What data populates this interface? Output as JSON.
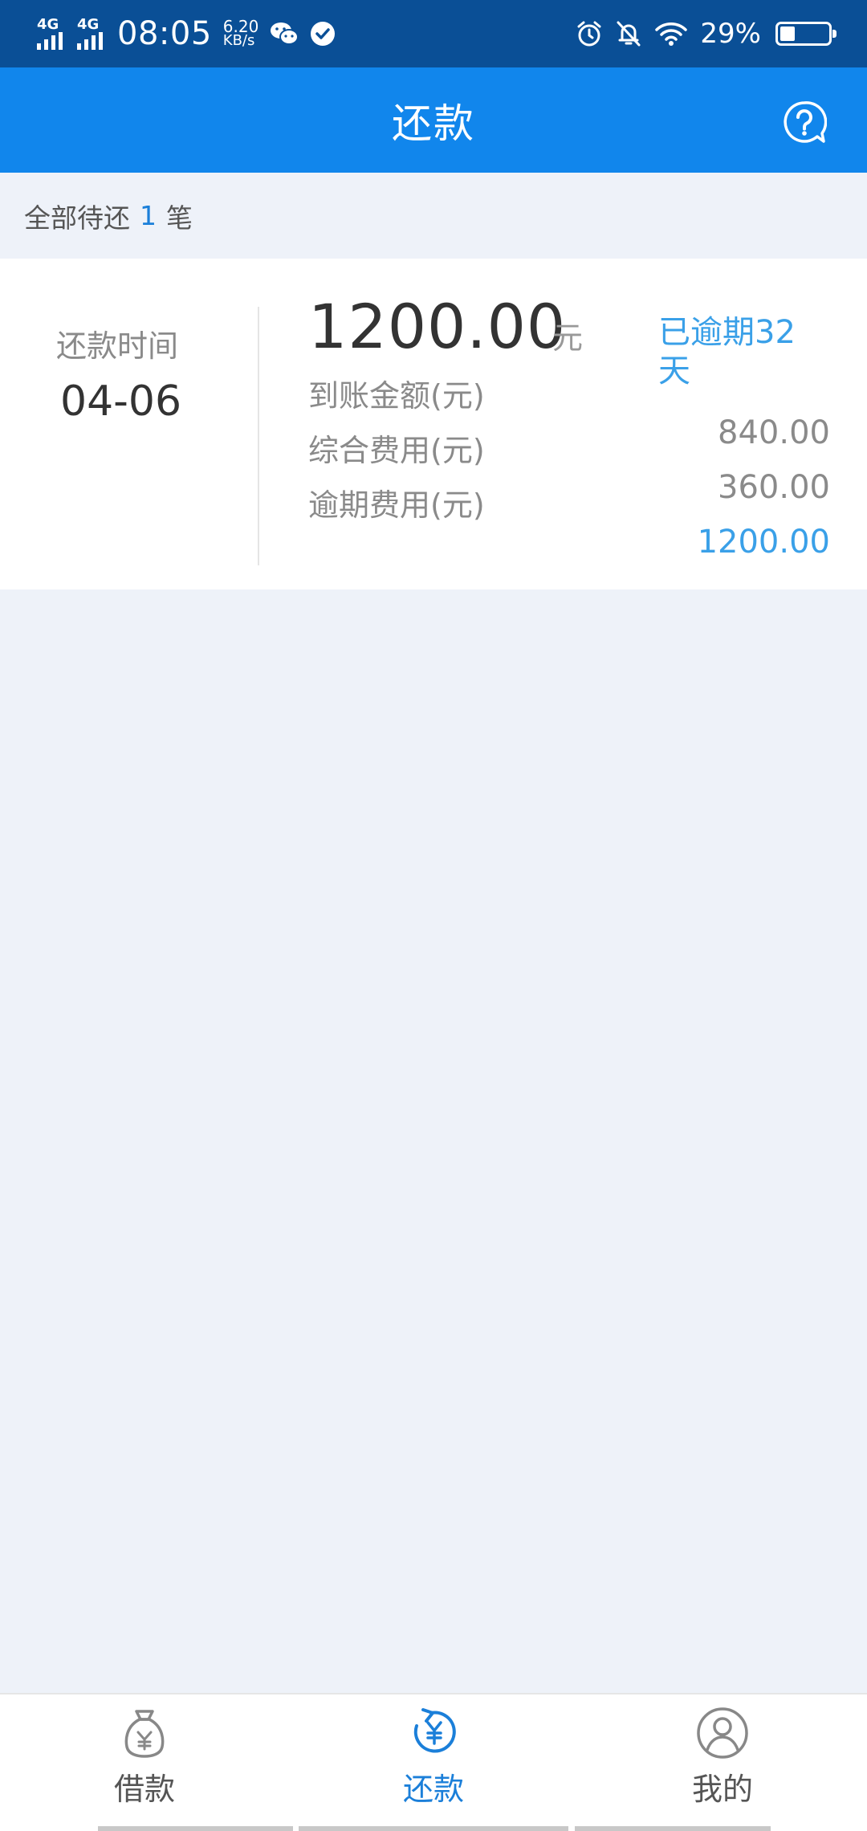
{
  "status_bar": {
    "network_1": "4G",
    "network_2": "4G",
    "time": "08:05",
    "speed_value": "6.20",
    "speed_unit": "KB/s",
    "battery": "29%",
    "icons": [
      "signal-icon",
      "wechat-icon",
      "check-circle-icon",
      "alarm-icon",
      "mute-bell-icon",
      "wifi-icon",
      "battery-icon"
    ]
  },
  "header": {
    "title": "还款",
    "help_icon": "help-question-icon"
  },
  "summary": {
    "prefix": "全部待还",
    "count": "1",
    "suffix": "笔"
  },
  "card": {
    "due_label": "还款时间",
    "due_date": "04-06",
    "amount": "1200.00",
    "amount_unit": "元",
    "overdue": "已逾期32天",
    "rows": [
      {
        "label": "到账金额(元)",
        "value": "840.00"
      },
      {
        "label": "综合费用(元)",
        "value": "360.00"
      },
      {
        "label": "逾期费用(元)",
        "value": "1200.00"
      }
    ]
  },
  "nav": {
    "items": [
      {
        "label": "借款",
        "icon": "money-bag-icon",
        "active": false
      },
      {
        "label": "还款",
        "icon": "repay-yuan-icon",
        "active": true
      },
      {
        "label": "我的",
        "icon": "user-icon",
        "active": false
      }
    ]
  },
  "colors": {
    "status_bar": "#0a4f96",
    "header": "#1186ec",
    "accent": "#1b7fd9",
    "overdue": "#3aa0e8",
    "background": "#eef2f9"
  }
}
